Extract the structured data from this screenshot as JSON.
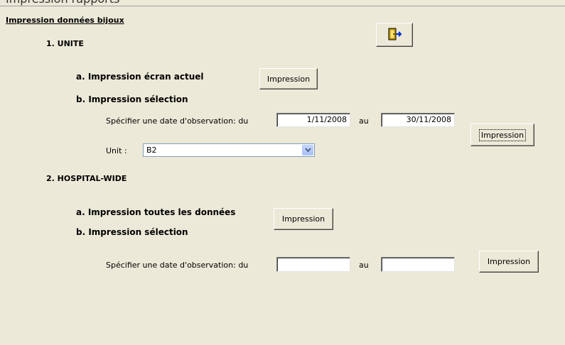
{
  "window": {
    "title": "Impression rapports"
  },
  "form": {
    "title": "Impression données bijoux",
    "exit_icon": "exit-door-icon",
    "unite": {
      "heading": "1. UNITE",
      "a_label": "a. Impression écran actuel",
      "a_button": "Impression",
      "b_label": "b. Impression sélection",
      "date_label": "Spécifier une date d'observation: du",
      "date_from": "1/11/2008",
      "au_label": "au",
      "date_to": "30/11/2008",
      "b_button": "Impression",
      "unit_label": "Unit :",
      "unit_value": "B2"
    },
    "hospital": {
      "heading": "2. HOSPITAL-WIDE",
      "a_label": "a. Impression toutes les données",
      "a_button": "Impression",
      "b_label": "b. Impression sélection",
      "date_label": "Spécifier une date d'observation: du",
      "date_from": "",
      "au_label": "au",
      "date_to": "",
      "b_button": "Impression"
    }
  }
}
